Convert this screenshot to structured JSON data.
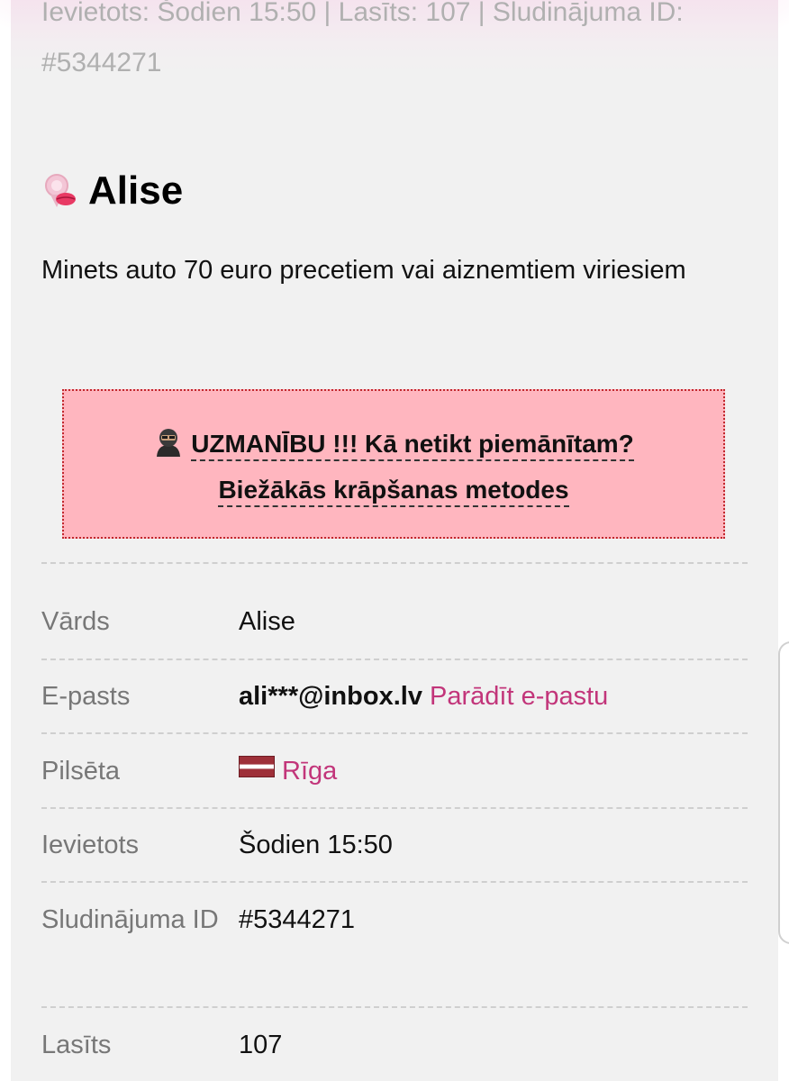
{
  "meta": {
    "text": "Ievietots: Šodien 15:50 | Lasīts: 107 | Sludinājuma ID: #5344271"
  },
  "ad": {
    "title_icon": "lips-badge-icon",
    "title": "Alise",
    "description": "Minets auto 70 euro precetiem vai aiznemtiem viriesiem"
  },
  "warning": {
    "icon": "hacker-icon",
    "line1": "UZMANĪBU !!! Kā netikt piemānītam?",
    "line2": "Biežākās krāpšanas metodes",
    "background_color": "#ffb6bf",
    "border_color": "#c1272d"
  },
  "details": {
    "name": {
      "label": "Vārds",
      "value": "Alise"
    },
    "email": {
      "label": "E-pasts",
      "masked": "ali***@inbox.lv",
      "reveal_link": "Parādīt e-pastu"
    },
    "city": {
      "label": "Pilsēta",
      "flag_icon": "latvia-flag-icon",
      "value": "Rīga"
    },
    "posted": {
      "label": "Ievietots",
      "value": "Šodien 15:50"
    },
    "ad_id": {
      "label": "Sludinājuma ID",
      "value": "#5344271"
    },
    "views": {
      "label": "Lasīts",
      "value": "107"
    }
  },
  "colors": {
    "link": "#c2357a",
    "label": "#777777",
    "card_background": "#f1f1f1"
  }
}
